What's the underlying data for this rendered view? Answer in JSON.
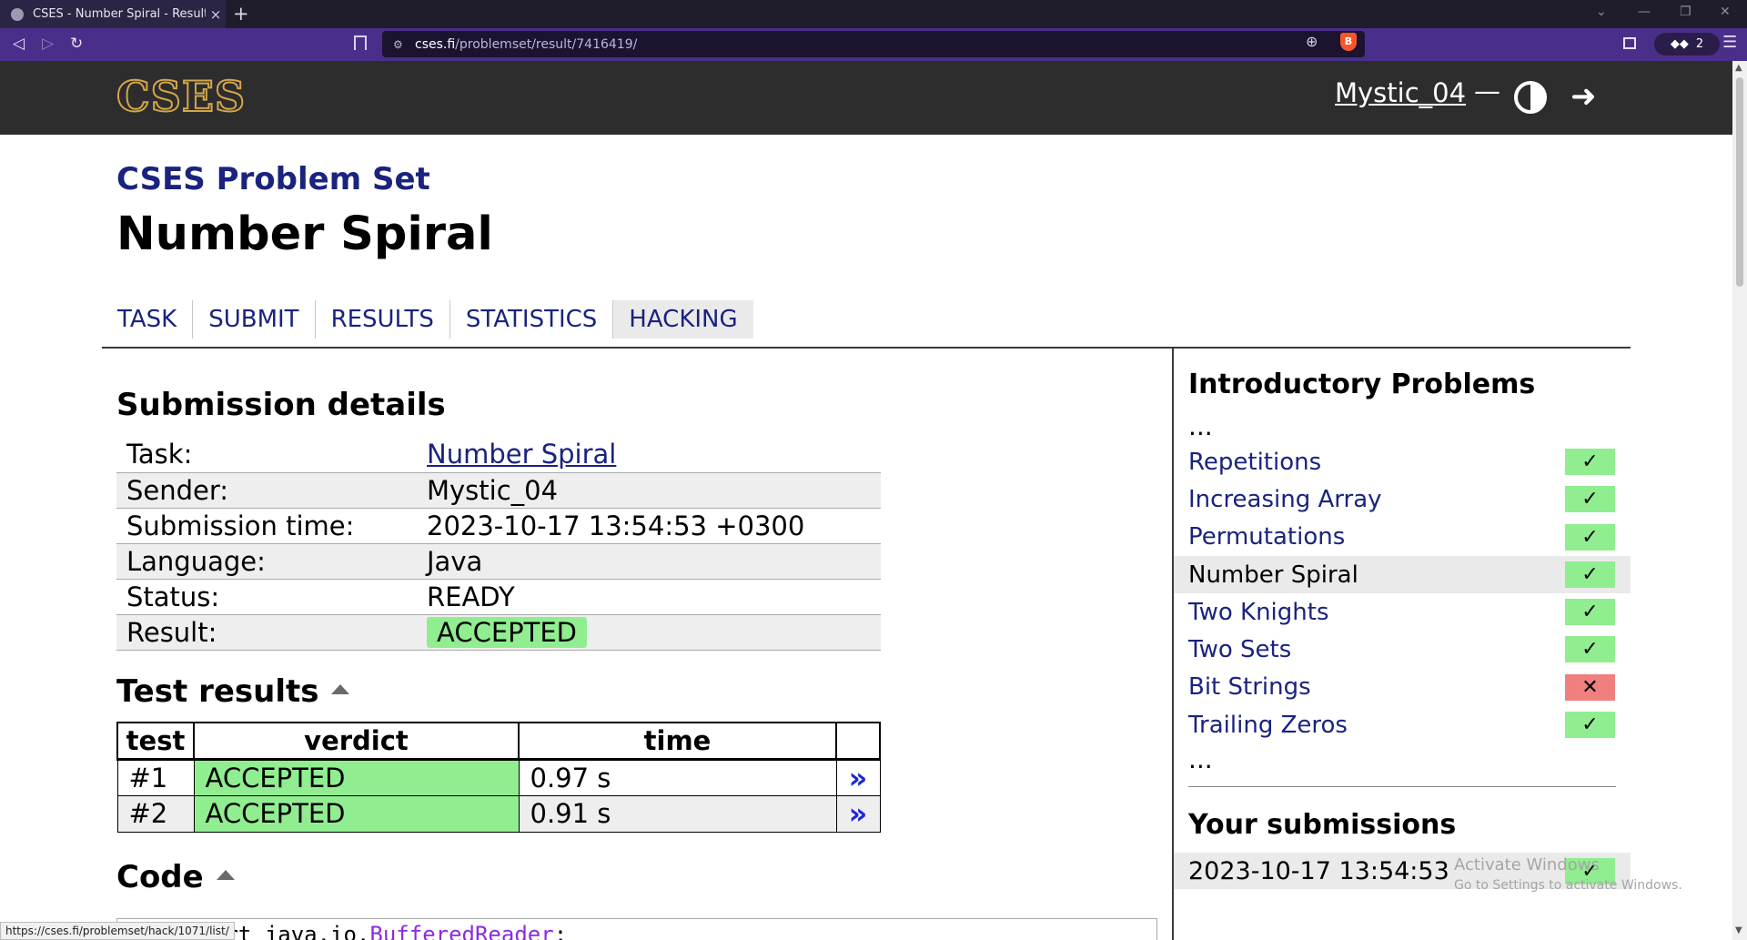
{
  "browser": {
    "tab_title": "CSES - Number Spiral - Results",
    "tab_close": "×",
    "new_tab": "+",
    "url_domain": "cses.fi",
    "url_path": "/problemset/result/7416419/",
    "wallet_count": "2",
    "status_url": "https://cses.fi/problemset/hack/1071/list/"
  },
  "site": {
    "logo": "CSES",
    "username": "Mystic_04",
    "dash": "—"
  },
  "page": {
    "problem_set_title": "CSES Problem Set",
    "task_title": "Number Spiral",
    "tabs": [
      "TASK",
      "SUBMIT",
      "RESULTS",
      "STATISTICS",
      "HACKING"
    ]
  },
  "submission": {
    "heading": "Submission details",
    "rows": [
      {
        "label": "Task:",
        "value": "Number Spiral"
      },
      {
        "label": "Sender:",
        "value": "Mystic_04"
      },
      {
        "label": "Submission time:",
        "value": "2023-10-17 13:54:53 +0300"
      },
      {
        "label": "Language:",
        "value": "Java"
      },
      {
        "label": "Status:",
        "value": "READY"
      },
      {
        "label": "Result:",
        "value": "ACCEPTED"
      }
    ]
  },
  "tests": {
    "heading": "Test results",
    "headers": [
      "test",
      "verdict",
      "time"
    ],
    "rows": [
      {
        "test": "#1",
        "verdict": "ACCEPTED",
        "time": "0.97 s",
        "link": "»"
      },
      {
        "test": "#2",
        "verdict": "ACCEPTED",
        "time": "0.91 s",
        "link": "»"
      }
    ]
  },
  "code": {
    "heading": "Code",
    "first_line_visible": "ort java.io.",
    "first_line_class": "BufferedReader",
    "first_line_end": ";"
  },
  "sidebar": {
    "heading": "Introductory Problems",
    "ellipsis": "...",
    "problems": [
      {
        "name": "Repetitions",
        "status": "✓"
      },
      {
        "name": "Increasing Array",
        "status": "✓"
      },
      {
        "name": "Permutations",
        "status": "✓"
      },
      {
        "name": "Number Spiral",
        "status": "✓"
      },
      {
        "name": "Two Knights",
        "status": "✓"
      },
      {
        "name": "Two Sets",
        "status": "✓"
      },
      {
        "name": "Bit Strings",
        "status": "✕"
      },
      {
        "name": "Trailing Zeros",
        "status": "✓"
      }
    ],
    "submissions_heading": "Your submissions",
    "submissions": [
      {
        "time": "2023-10-17 13:54:53",
        "status": "✓"
      }
    ]
  },
  "watermark": {
    "line1": "Activate Windows",
    "line2": "Go to Settings to activate Windows."
  },
  "colors": {
    "accepted": "#90ee90",
    "rejected": "#f08080",
    "link": "#1a237e",
    "browser_toolbar": "#4a2f8a"
  }
}
